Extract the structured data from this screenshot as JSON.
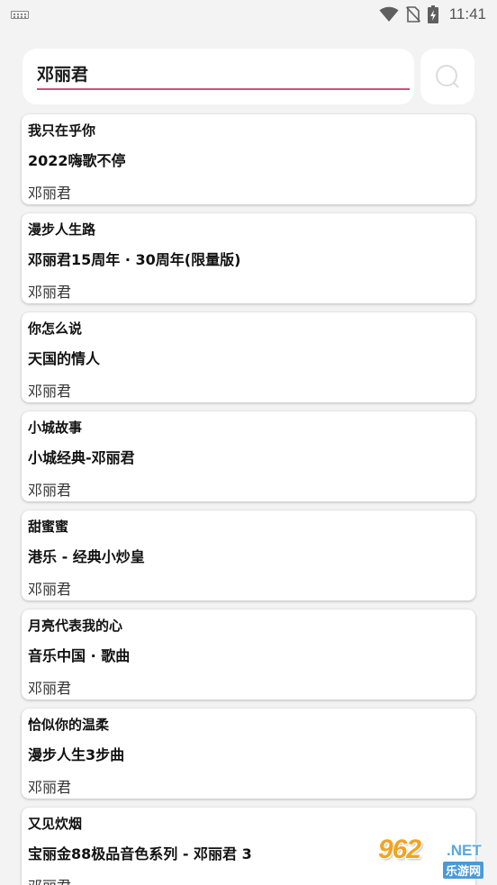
{
  "status_bar": {
    "time": "11:41",
    "icons": [
      "keyboard-icon",
      "wifi-icon",
      "no-sim-icon",
      "battery-charging-icon"
    ]
  },
  "search": {
    "query": "邓丽君",
    "button_icon": "search-icon",
    "accent_color": "#d24f7d"
  },
  "results": [
    {
      "title": "我只在乎你",
      "album": "2022嗨歌不停",
      "artist": "邓丽君"
    },
    {
      "title": "漫步人生路",
      "album": "邓丽君15周年 · 30周年(限量版)",
      "artist": "邓丽君"
    },
    {
      "title": "你怎么说",
      "album": "天国的情人",
      "artist": "邓丽君"
    },
    {
      "title": "小城故事",
      "album": "小城经典-邓丽君",
      "artist": "邓丽君"
    },
    {
      "title": "甜蜜蜜",
      "album": "港乐 - 经典小炒皇",
      "artist": "邓丽君"
    },
    {
      "title": "月亮代表我的心",
      "album": "音乐中国 · 歌曲",
      "artist": "邓丽君"
    },
    {
      "title": "恰似你的温柔",
      "album": "漫步人生3步曲",
      "artist": "邓丽君"
    },
    {
      "title": "又见炊烟",
      "album": "宝丽金88极品音色系列 - 邓丽君 3",
      "artist": "邓丽君"
    }
  ],
  "watermark": {
    "main": "962",
    "net": ".NET",
    "sub": "乐游网"
  }
}
